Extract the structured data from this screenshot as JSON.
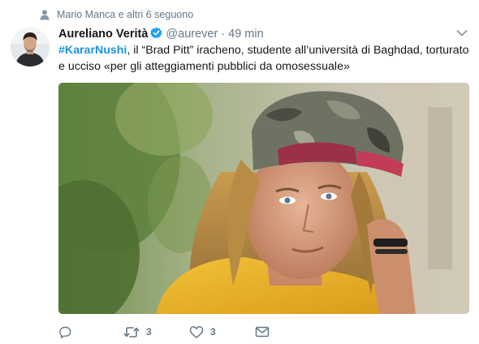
{
  "context": {
    "icon": "person-icon",
    "text": "Mario Manca e altri 6 seguono"
  },
  "author": {
    "fullname": "Aureliano Verità",
    "handle": "@aurever",
    "separator": "·",
    "time": "49 min",
    "verified": true
  },
  "tweet": {
    "hashtag": "#KararNushi",
    "body": ", il “Brad Pitt” iracheno, studente all’università di Baghdad, torturato e ucciso «per gli atteggiamenti pubblici da omosessuale»"
  },
  "actions": {
    "reply": {
      "icon": "reply-icon",
      "count": ""
    },
    "retweet": {
      "icon": "retweet-icon",
      "count": "3"
    },
    "like": {
      "icon": "heart-icon",
      "count": "3"
    },
    "dm": {
      "icon": "envelope-icon",
      "count": ""
    }
  },
  "colors": {
    "link": "#1b95e0",
    "muted": "#657786",
    "text": "#14171a",
    "verified": "#1da1f2"
  }
}
